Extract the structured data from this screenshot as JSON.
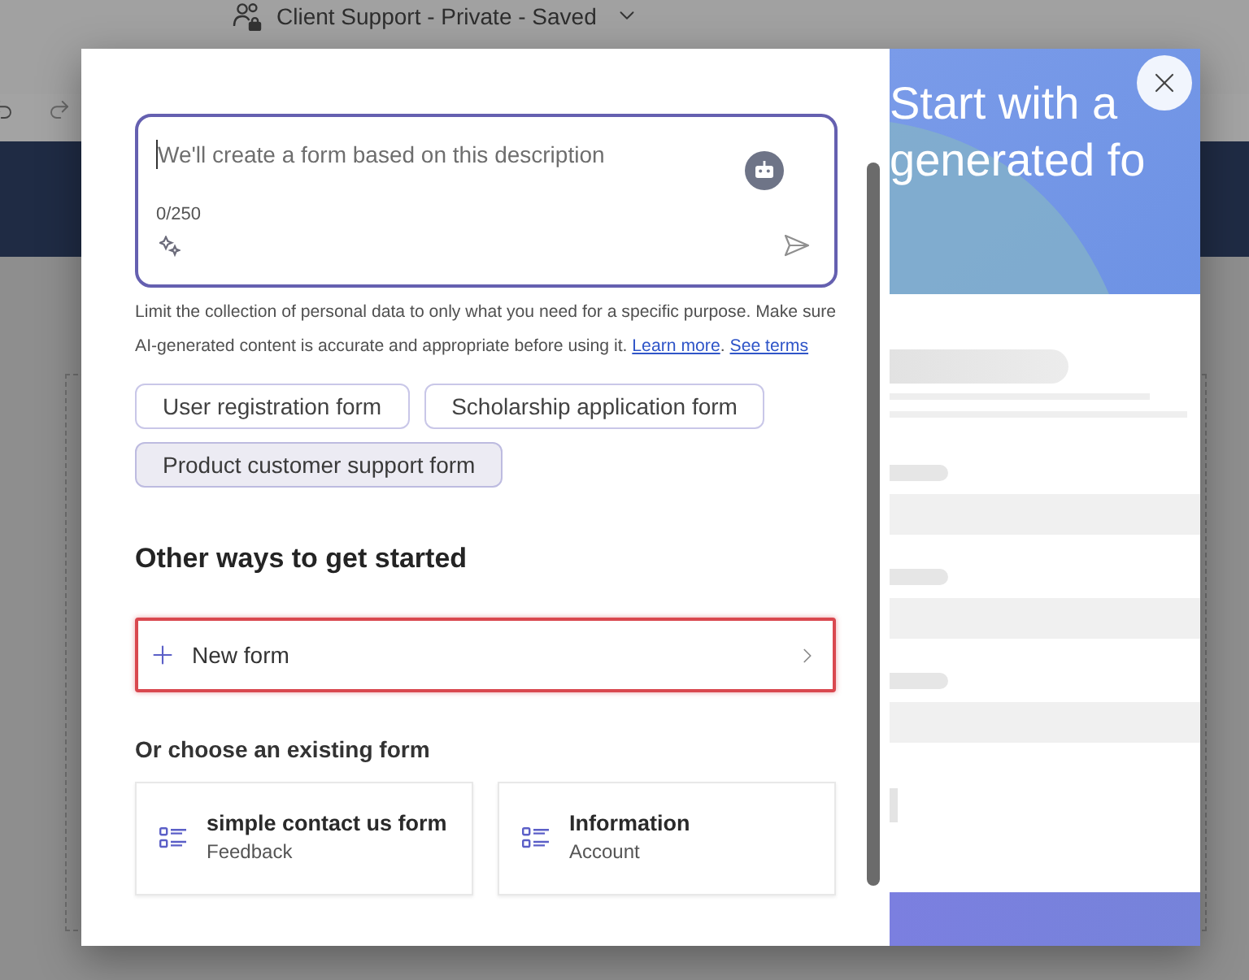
{
  "header": {
    "title": "Client Support - Private - Saved"
  },
  "prompt": {
    "placeholder": "We'll create a form based on this description",
    "counter": "0/250"
  },
  "disclaimer": {
    "text": "Limit the collection of personal data to only what you need for a specific purpose. Make sure AI-generated content is accurate and appropriate before using it.",
    "links": [
      {
        "label": "Learn more",
        "trailing": "."
      },
      {
        "label": "See terms"
      }
    ]
  },
  "suggestions": [
    {
      "label": "User registration form",
      "selected": false
    },
    {
      "label": "Scholarship application form",
      "selected": false
    },
    {
      "label": "Product customer support form",
      "selected": true
    }
  ],
  "other_ways": {
    "heading": "Other ways to get started",
    "new_form": "New form"
  },
  "existing": {
    "heading": "Or choose an existing form",
    "forms": [
      {
        "title": "simple contact us form",
        "subtitle": "Feedback"
      },
      {
        "title": "Information",
        "subtitle": "Account"
      }
    ]
  },
  "promo": {
    "lines": [
      "Start with a",
      "generated fo"
    ]
  }
}
